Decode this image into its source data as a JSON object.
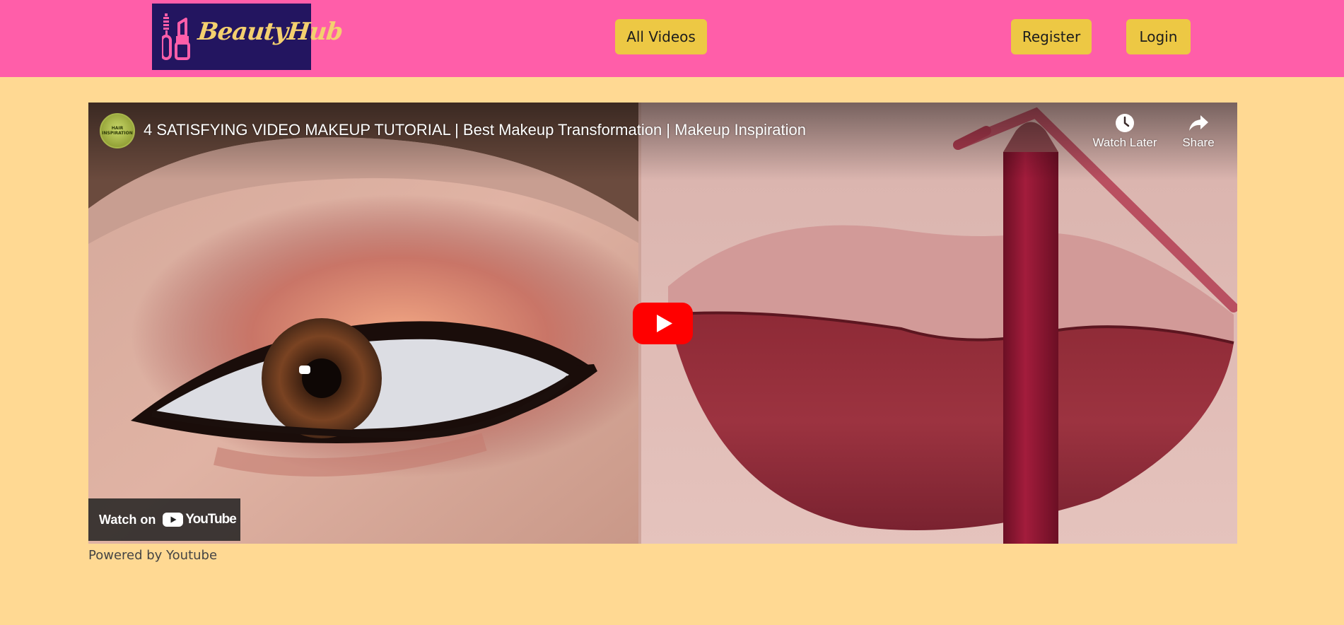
{
  "header": {
    "logo_text": "BeautyHub",
    "nav": {
      "all_videos": "All Videos",
      "register": "Register",
      "login": "Login"
    }
  },
  "video": {
    "title": "4 SATISFYING VIDEO MAKEUP TUTORIAL | Best Makeup Transformation | Makeup Inspiration",
    "channel_avatar_text": "HAIR INSPIRATION",
    "controls": {
      "watch_later": "Watch Later",
      "share": "Share"
    },
    "watch_on_label": "Watch on",
    "youtube_word": "YouTube",
    "play_icon": "play-icon"
  },
  "footer": {
    "powered_by": "Powered by Youtube"
  },
  "colors": {
    "header_bg": "#FF5EA9",
    "page_bg": "#FFD993",
    "button_bg": "#EDC844",
    "logo_bg": "#231560",
    "logo_text": "#F4D06F",
    "youtube_red": "#FF0000"
  }
}
